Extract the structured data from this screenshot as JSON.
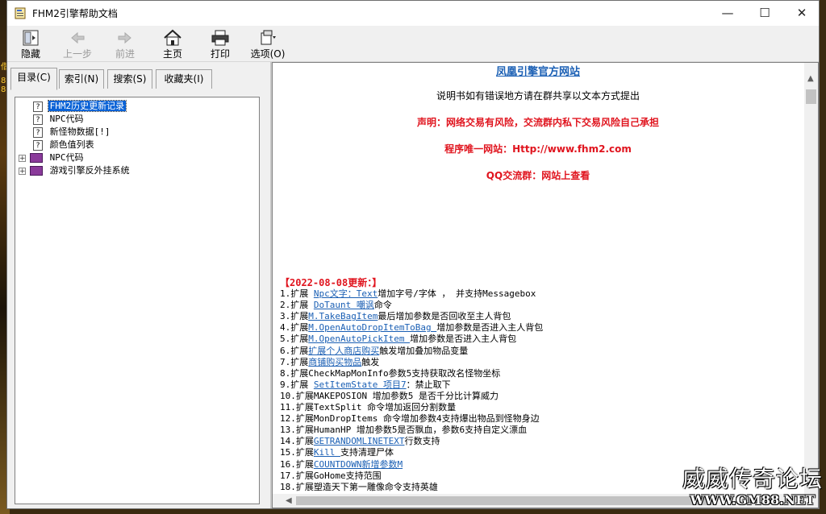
{
  "window": {
    "title": "FHM2引擎帮助文档"
  },
  "toolbar": [
    {
      "label": "隐藏",
      "icon": "hide-icon",
      "enabled": true
    },
    {
      "label": "上一步",
      "icon": "back-arrow-icon",
      "enabled": false
    },
    {
      "label": "前进",
      "icon": "forward-arrow-icon",
      "enabled": false
    },
    {
      "label": "主页",
      "icon": "home-icon",
      "enabled": true
    },
    {
      "label": "打印",
      "icon": "printer-icon",
      "enabled": true
    },
    {
      "label": "选项(O)",
      "icon": "options-icon",
      "enabled": true
    }
  ],
  "tabs": [
    {
      "label": "目录(C)",
      "active": true
    },
    {
      "label": "索引(N)",
      "active": false
    },
    {
      "label": "搜索(S)",
      "active": false
    },
    {
      "label": "收藏夹(I)",
      "active": false
    }
  ],
  "tree": [
    {
      "label": "FHM2历史更新记录",
      "type": "page",
      "selected": true
    },
    {
      "label": "NPC代码",
      "type": "page",
      "selected": false
    },
    {
      "label": "新怪物数据[!]",
      "type": "page",
      "selected": false
    },
    {
      "label": "颜色值列表",
      "type": "page",
      "selected": false
    },
    {
      "label": "NPC代码",
      "type": "book",
      "selected": false
    },
    {
      "label": "游戏引擎反外挂系统",
      "type": "book",
      "selected": false
    }
  ],
  "content": {
    "official_link": "凤凰引擎官方网站",
    "notice": "说明书如有错误地方请在群共享以文本方式提出",
    "statement": "声明：网络交易有风险，交流群内私下交易风险自己承担",
    "website": "程序唯一网站：Http://www.fhm2.com",
    "qq_group": "QQ交流群：网站上查看",
    "update_heading": "【2022-08-08更新：】",
    "updates": [
      {
        "prefix": "1.扩展 ",
        "link": "Npc文字：Text",
        "suffix": "增加字号/字体 ， 并支持Messagebox"
      },
      {
        "prefix": "2.扩展 ",
        "link": "DoTaunt 嘲讽",
        "suffix": "命令"
      },
      {
        "prefix": "3.扩展",
        "link": "M.TakeBagItem",
        "suffix": "最后增加参数是否回收至主人背包"
      },
      {
        "prefix": "4.扩展",
        "link": "M.OpenAutoDropItemToBag ",
        "suffix": "增加参数是否进入主人背包"
      },
      {
        "prefix": "5.扩展",
        "link": "M.OpenAutoPickItem ",
        "suffix": "增加参数是否进入主人背包"
      },
      {
        "prefix": "6.扩展",
        "link": "扩展个人商店购买",
        "suffix": "触发增加叠加物品变量"
      },
      {
        "prefix": "7.扩展",
        "link": "商铺购买物品",
        "suffix": "触发"
      },
      {
        "prefix": "8.扩展CheckMapMonInfo参数5支持获取改名怪物坐标",
        "link": "",
        "suffix": ""
      },
      {
        "prefix": "9.扩展 ",
        "link": "SetItemState 项目7",
        "suffix": "：禁止取下"
      },
      {
        "prefix": "10.扩展MAKEPOSION 增加参数5 是否千分比计算威力",
        "link": "",
        "suffix": ""
      },
      {
        "prefix": "11.扩展TextSplit 命令增加返回分割数量",
        "link": "",
        "suffix": ""
      },
      {
        "prefix": "12.扩展MonDropItems 命令增加参数4支持爆出物品到怪物身边",
        "link": "",
        "suffix": ""
      },
      {
        "prefix": "13.扩展HumanHP 增加参数5是否飘血，参数6支持自定义漂血",
        "link": "",
        "suffix": ""
      },
      {
        "prefix": "14.扩展",
        "link": "GETRANDOMLINETEXT",
        "suffix": "行数支持"
      },
      {
        "prefix": "15.扩展",
        "link": "Kill ",
        "suffix": "支持清理尸体"
      },
      {
        "prefix": "16.扩展",
        "link": "COUNTDOWN新增参数M",
        "suffix": ""
      },
      {
        "prefix": "17.扩展GoHome支持范围",
        "link": "",
        "suffix": ""
      },
      {
        "prefix": "18.扩展塑造天下第一雕像命令支持英雄",
        "link": "",
        "suffix": ""
      }
    ]
  },
  "watermark": {
    "line1": "威威传奇论坛",
    "line2": "WWW.GM88.NET"
  },
  "background_strip": [
    "借",
    "8",
    "8"
  ]
}
